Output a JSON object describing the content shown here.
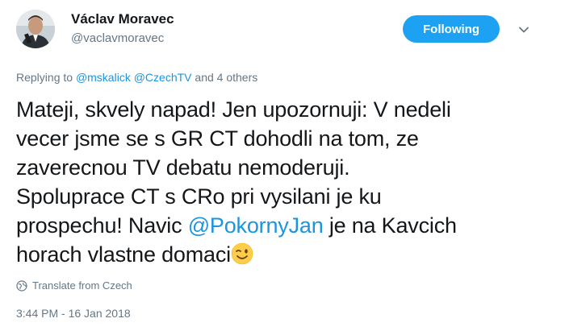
{
  "tweet": {
    "author_name": "Václav Moravec",
    "author_handle": "@vaclavmoravec",
    "follow_button_label": "Following",
    "replying_prefix": "Replying to",
    "replying_mentions": [
      "@mskalick",
      "@CzechTV"
    ],
    "replying_suffix": "and 4 others",
    "text_lines": [
      "Mateji, skvely napad! Jen upozornuji: V nedeli",
      "vecer jsme se s GR CT dohodli na tom, ze",
      "zaverecnou TV debatu nemoderuji.",
      "Spoluprace CT s CRo pri vysilani je ku",
      "prospechu! Navic",
      "@PokornyJan",
      "je na Kavcich",
      "horach vlastne domaci"
    ],
    "emoji_icon": "winking-face-emoji",
    "translate_label": "Translate from Czech",
    "timestamp": "3:44 PM - 16 Jan 2018"
  },
  "colors": {
    "accent": "#1da1f2",
    "link": "#1b95e0",
    "secondary_text": "#657786",
    "primary_text": "#14171a"
  }
}
